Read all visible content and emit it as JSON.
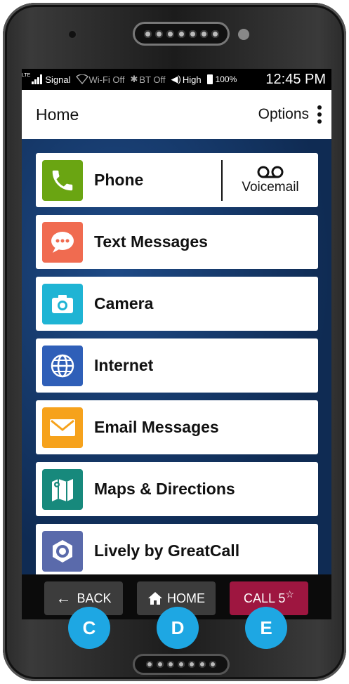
{
  "status_bar": {
    "network_type": "LTE",
    "signal_label": "Signal",
    "wifi_label": "Wi-Fi Off",
    "bt_label": "BT Off",
    "volume_label": "High",
    "battery_label": "100%",
    "time": "12:45 PM"
  },
  "app_bar": {
    "title": "Home",
    "options_label": "Options"
  },
  "list_items": [
    {
      "label": "Phone",
      "icon": "phone-icon",
      "color": "#6aa512"
    },
    {
      "label": "Text Messages",
      "icon": "chat-bubble-icon",
      "color": "#f06b50"
    },
    {
      "label": "Camera",
      "icon": "camera-icon",
      "color": "#1fb4d4"
    },
    {
      "label": "Internet",
      "icon": "globe-icon",
      "color": "#2f5fb8"
    },
    {
      "label": "Email Messages",
      "icon": "envelope-icon",
      "color": "#f6a21c"
    },
    {
      "label": "Maps & Directions",
      "icon": "map-icon",
      "color": "#17897c"
    },
    {
      "label": "Lively by GreatCall",
      "icon": "lively-icon",
      "color": "#5a6aab"
    }
  ],
  "voicemail": {
    "label": "Voicemail",
    "icon": "voicemail-icon"
  },
  "nav_bar": {
    "back_label": "BACK",
    "home_label": "HOME",
    "call_label": "CALL 5",
    "call_star": "☆",
    "call_color": "#9e1640"
  },
  "callouts": [
    "C",
    "D",
    "E"
  ]
}
